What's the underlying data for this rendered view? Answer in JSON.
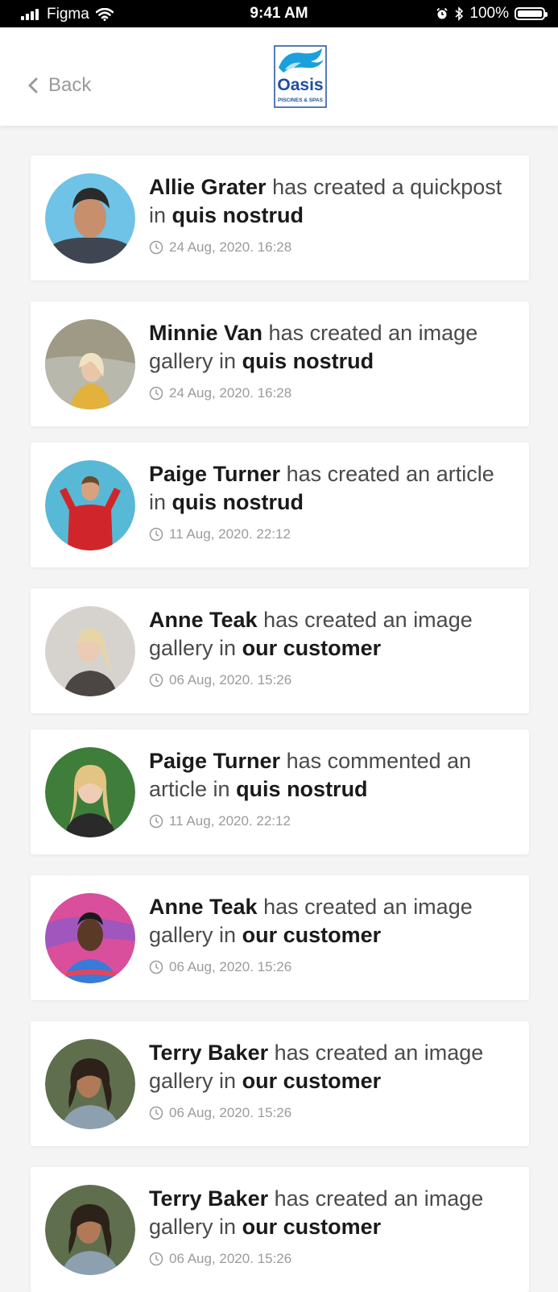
{
  "status_bar": {
    "carrier": "Figma",
    "time": "9:41 AM",
    "battery": "100%",
    "battery_level": 1.0
  },
  "nav": {
    "back_label": "Back",
    "logo_text": "Oasis",
    "logo_subtext": "PISCINES & SPAS"
  },
  "colors": {
    "background": "#f4f4f4",
    "card": "#ffffff",
    "text_primary": "#1a1a1a",
    "text_secondary": "#4a4a4a",
    "meta": "#9b9b9b",
    "logo_blue": "#1f4fa0",
    "logo_accent": "#1aa0dc"
  },
  "feed": [
    {
      "actor": "Allie Grater",
      "action": "has created a quickpost in",
      "target": "quis nostrud",
      "timestamp": "24 Aug, 2020. 16:28"
    },
    {
      "actor": "Minnie Van",
      "action": "has created an image gallery in",
      "target": "quis nostrud",
      "timestamp": "24 Aug, 2020. 16:28"
    },
    {
      "actor": "Paige Turner",
      "action": "has created an article in",
      "target": "quis nostrud",
      "timestamp": "11 Aug, 2020. 22:12"
    },
    {
      "actor": "Anne Teak",
      "action": "has created an image gallery in",
      "target": "our customer",
      "timestamp": "06 Aug, 2020. 15:26"
    },
    {
      "actor": "Paige Turner",
      "action": "has commented an article in",
      "target": "quis nostrud",
      "timestamp": "11 Aug, 2020. 22:12"
    },
    {
      "actor": "Anne Teak",
      "action": "has created an image gallery in",
      "target": "our customer",
      "timestamp": "06 Aug, 2020. 15:26"
    },
    {
      "actor": "Terry Baker",
      "action": "has created an image gallery in",
      "target": "our customer",
      "timestamp": "06 Aug, 2020. 15:26"
    },
    {
      "actor": "Terry Baker",
      "action": "has created an image gallery in",
      "target": "our customer",
      "timestamp": "06 Aug, 2020. 15:26"
    }
  ]
}
